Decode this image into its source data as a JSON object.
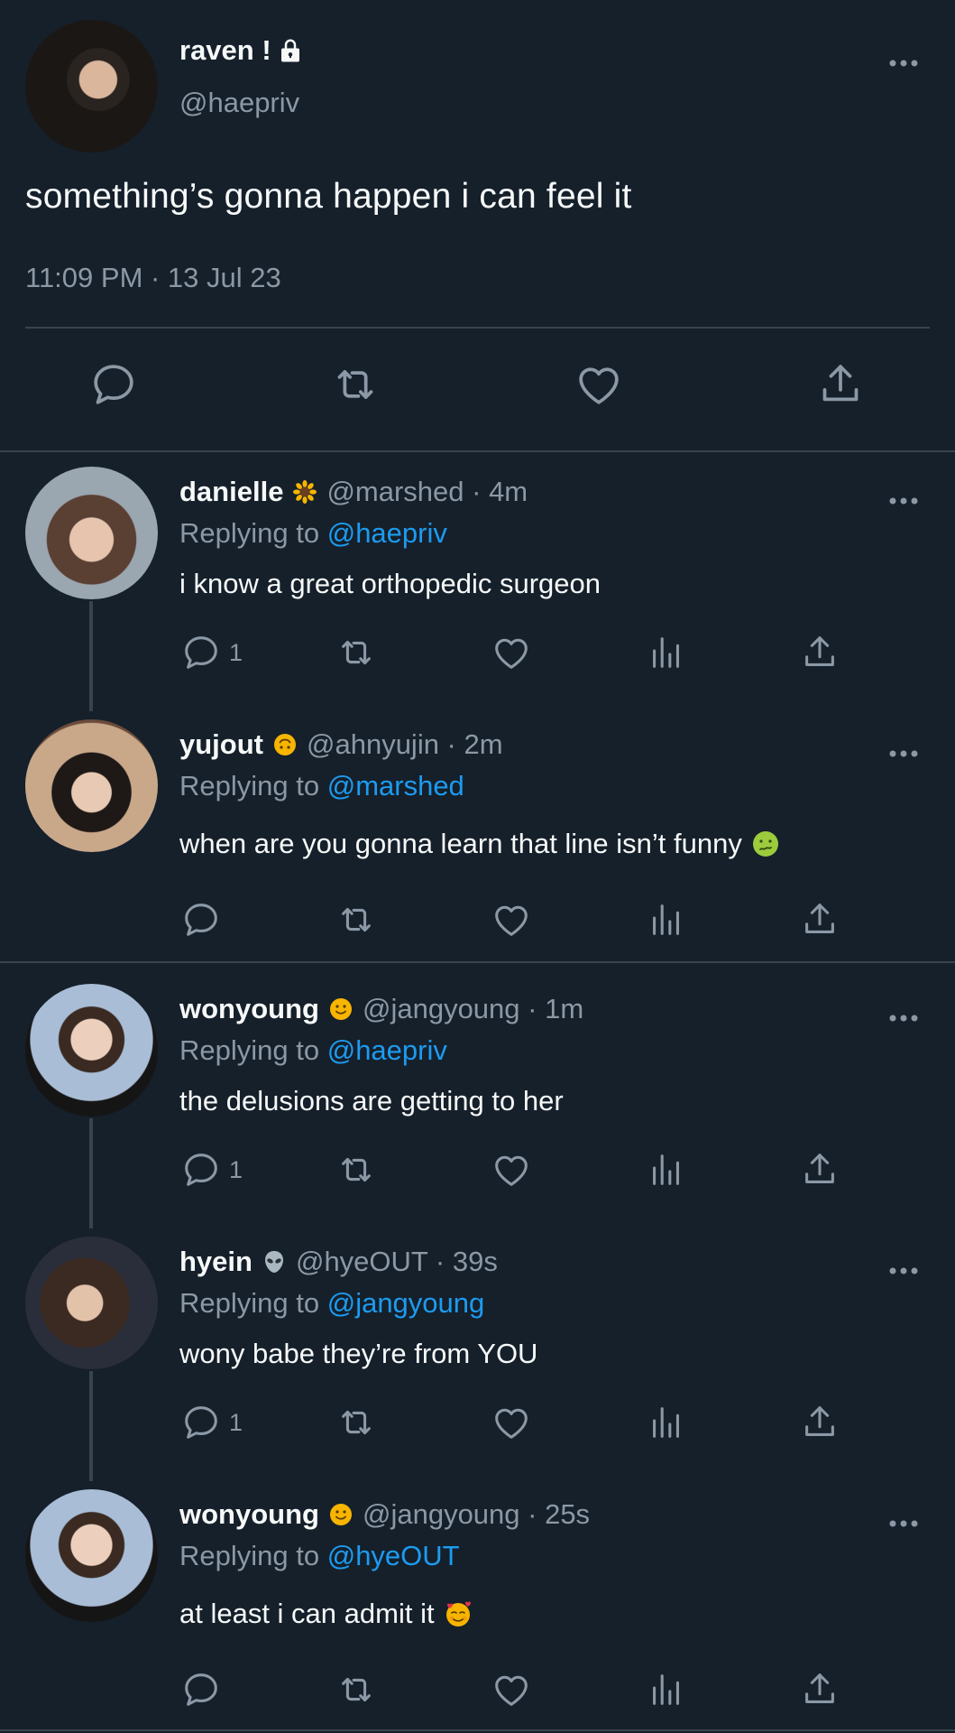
{
  "main_tweet": {
    "display_name": "raven !",
    "handle": "@haepriv",
    "text": "something’s gonna happen i can feel it",
    "timestamp": "11:09 PM · 13 Jul 23"
  },
  "replies": [
    {
      "name": "danielle",
      "emoji": "sunflower-emoji",
      "handle_time": "@marshed · 4m",
      "replying_prefix": "Replying to ",
      "replying_to": "@haepriv",
      "text": "i know a great orthopedic surgeon",
      "reply_count": "1",
      "text_emoji": ""
    },
    {
      "name": "yujout",
      "emoji": "upside-down-face-emoji",
      "handle_time": "@ahnyujin · 2m",
      "replying_prefix": "Replying to ",
      "replying_to": "@marshed",
      "text": "when are you gonna learn that line isn’t funny",
      "reply_count": "",
      "text_emoji": "nauseated-face-emoji"
    },
    {
      "name": "wonyoung",
      "emoji": "slightly-smiling-face-emoji",
      "handle_time": "@jangyoung · 1m",
      "replying_prefix": "Replying to ",
      "replying_to": "@haepriv",
      "text": "the delusions are getting to her",
      "reply_count": "1",
      "text_emoji": ""
    },
    {
      "name": "hyein",
      "emoji": "alien-emoji",
      "handle_time": "@hyeOUT · 39s",
      "replying_prefix": "Replying to ",
      "replying_to": "@jangyoung",
      "text": "wony babe they’re from YOU",
      "reply_count": "1",
      "text_emoji": ""
    },
    {
      "name": "wonyoung",
      "emoji": "slightly-smiling-face-emoji",
      "handle_time": "@jangyoung · 25s",
      "replying_prefix": "Replying to ",
      "replying_to": "@hyeOUT",
      "text": "at least i can admit it",
      "reply_count": "",
      "text_emoji": "smiling-face-with-hearts-emoji"
    }
  ],
  "colors": {
    "background": "#15202b",
    "text": "#f7f9f9",
    "secondary": "#8b98a5",
    "link": "#1d9bf0",
    "divider": "#38444d"
  }
}
